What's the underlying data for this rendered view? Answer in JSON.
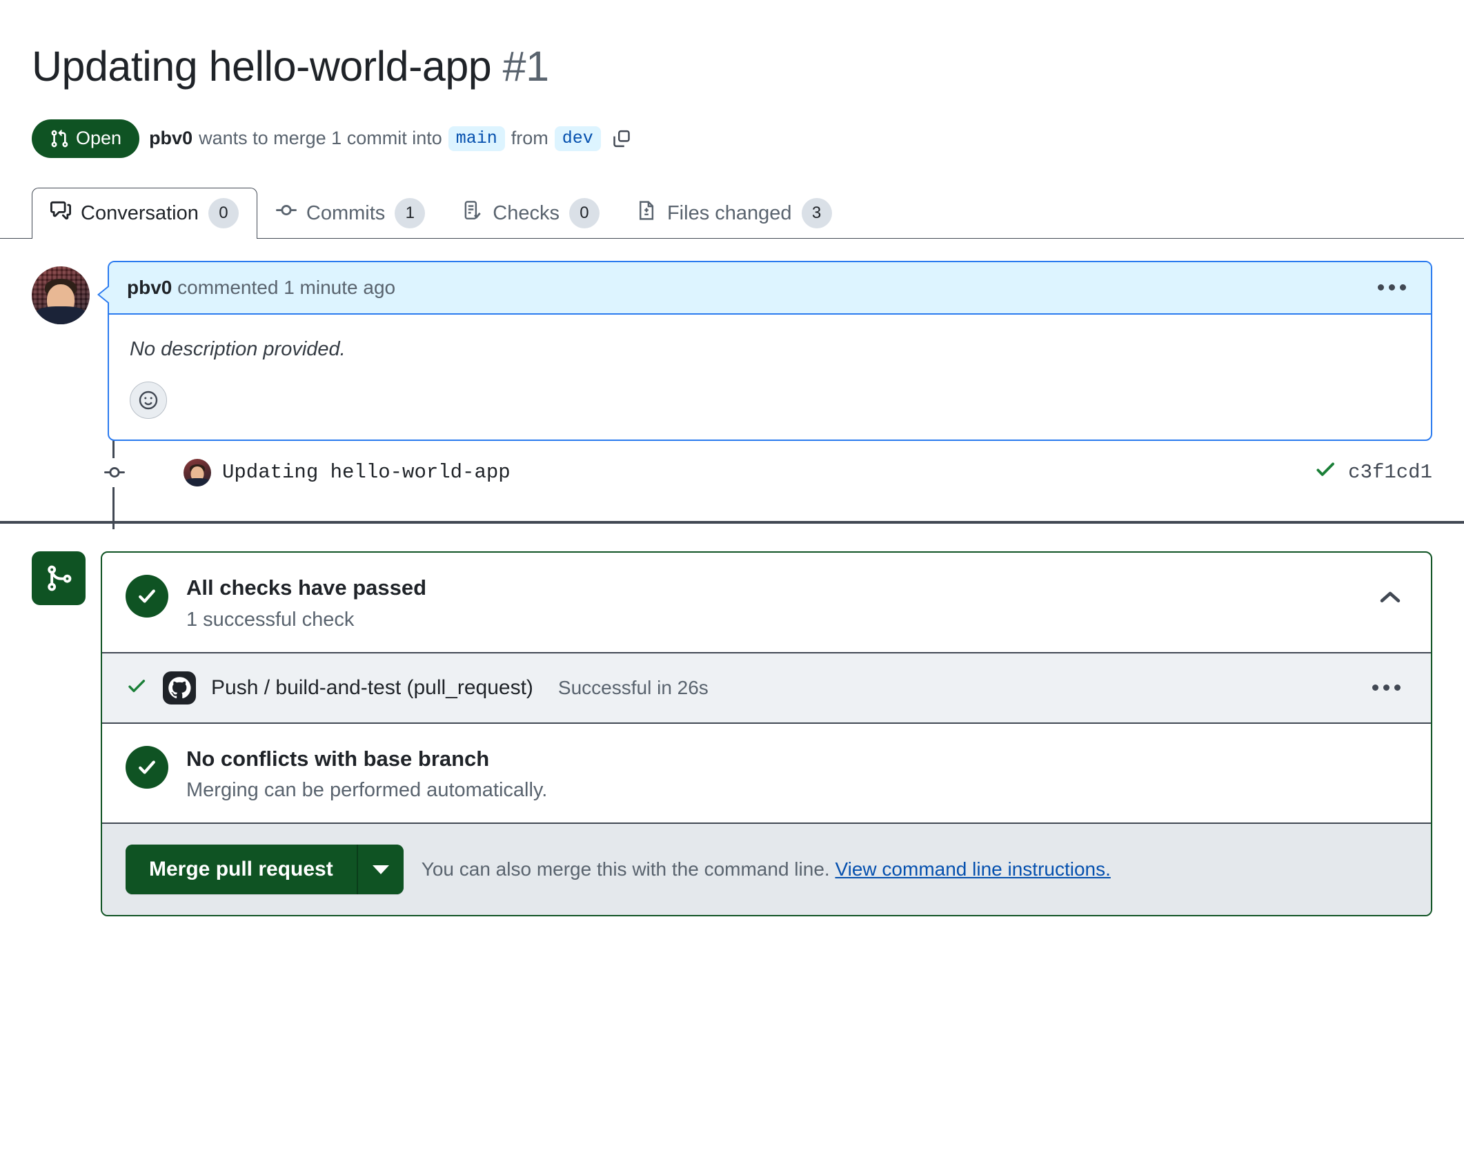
{
  "header": {
    "title": "Updating hello-world-app",
    "number": "#1",
    "state_label": "Open",
    "state_icon": "git-pull-request-icon",
    "state_color": "#0f5323",
    "author": "pbv0",
    "sentence_before": "wants to merge 1 commit into",
    "base_branch": "main",
    "sentence_middle": "from",
    "head_branch": "dev",
    "copy_icon": "copy-icon",
    "branch_chip_bg": "#ddf4ff",
    "branch_chip_color": "#0550ae"
  },
  "tabs": [
    {
      "label": "Conversation",
      "count": "0",
      "icon": "comment-discussion-icon",
      "active": true
    },
    {
      "label": "Commits",
      "count": "1",
      "icon": "git-commit-icon",
      "active": false
    },
    {
      "label": "Checks",
      "count": "0",
      "icon": "checklist-icon",
      "active": false
    },
    {
      "label": "Files changed",
      "count": "3",
      "icon": "file-diff-icon",
      "active": false
    }
  ],
  "comment": {
    "author": "pbv0",
    "meta": "commented 1 minute ago",
    "body": "No description provided.",
    "reaction_icon": "smiley-icon",
    "menu_icon": "kebab-horizontal-icon",
    "header_bg": "#ddf4ff",
    "border_color": "#2a7aef"
  },
  "commit": {
    "message": "Updating hello-world-app",
    "sha": "c3f1cd1",
    "status_icon": "check-icon",
    "node_icon": "git-commit-node-icon"
  },
  "merge_box": {
    "branch_icon": "git-merge-icon",
    "checks": {
      "title": "All checks have passed",
      "subtitle": "1 successful check",
      "collapse_icon": "chevron-up-icon"
    },
    "check_run": {
      "status_icon": "check-icon",
      "app_icon": "github-mark-icon",
      "name": "Push / build-and-test (pull_request)",
      "status": "Successful in 26s",
      "menu_icon": "kebab-horizontal-icon"
    },
    "conflicts": {
      "title": "No conflicts with base branch",
      "subtitle": "Merging can be performed automatically."
    },
    "footer": {
      "merge_label": "Merge pull request",
      "dropdown_icon": "triangle-down-icon",
      "note_before": "You can also merge this with the command line.",
      "link_label": "View command line instructions."
    },
    "accent_color": "#0f5323"
  }
}
